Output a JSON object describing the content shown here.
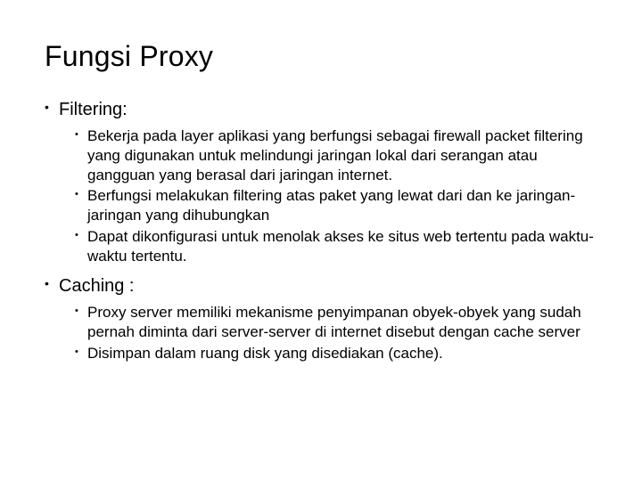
{
  "title": "Fungsi Proxy",
  "sections": [
    {
      "heading": "Filtering:",
      "items": [
        "Bekerja pada layer aplikasi yang berfungsi sebagai firewall packet filtering yang digunakan untuk melindungi jaringan lokal dari serangan atau gangguan yang berasal dari jaringan internet.",
        "Berfungsi melakukan filtering atas paket yang lewat dari dan ke jaringan- jaringan yang dihubungkan",
        "Dapat dikonfigurasi untuk menolak akses ke situs web tertentu pada waktu- waktu tertentu."
      ]
    },
    {
      "heading": "Caching :",
      "items": [
        "Proxy server memiliki mekanisme penyimpanan obyek-obyek yang sudah pernah diminta dari server-server di internet disebut dengan cache server",
        "Disimpan dalam ruang disk yang disediakan (cache)."
      ]
    }
  ]
}
